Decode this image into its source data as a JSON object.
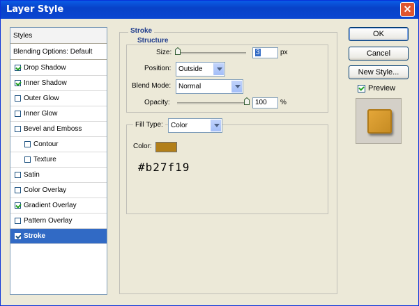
{
  "window": {
    "title": "Layer Style"
  },
  "styles_panel": {
    "header": "Styles",
    "blending_options": "Blending Options: Default",
    "items": [
      {
        "label": "Drop Shadow",
        "checked": true,
        "selected": false
      },
      {
        "label": "Inner Shadow",
        "checked": true,
        "selected": false
      },
      {
        "label": "Outer Glow",
        "checked": false,
        "selected": false
      },
      {
        "label": "Inner Glow",
        "checked": false,
        "selected": false
      },
      {
        "label": "Bevel and Emboss",
        "checked": false,
        "selected": false
      },
      {
        "label": "Contour",
        "checked": false,
        "selected": false,
        "indent": true
      },
      {
        "label": "Texture",
        "checked": false,
        "selected": false,
        "indent": true
      },
      {
        "label": "Satin",
        "checked": false,
        "selected": false
      },
      {
        "label": "Color Overlay",
        "checked": false,
        "selected": false
      },
      {
        "label": "Gradient Overlay",
        "checked": true,
        "selected": false
      },
      {
        "label": "Pattern Overlay",
        "checked": false,
        "selected": false
      },
      {
        "label": "Stroke",
        "checked": true,
        "selected": true
      }
    ]
  },
  "stroke": {
    "group_label": "Stroke",
    "structure_label": "Structure",
    "size_label": "Size:",
    "size_value": "3",
    "size_unit": "px",
    "position_label": "Position:",
    "position_value": "Outside",
    "blend_mode_label": "Blend Mode:",
    "blend_mode_value": "Normal",
    "opacity_label": "Opacity:",
    "opacity_value": "100",
    "opacity_unit": "%",
    "fill_type_label": "Fill Type:",
    "fill_type_value": "Color",
    "color_label": "Color:",
    "color_hex": "#b27f19",
    "color_hex_label": "#b27f19"
  },
  "buttons": {
    "ok": "OK",
    "cancel": "Cancel",
    "new_style": "New Style...",
    "preview_label": "Preview",
    "preview_checked": true
  },
  "colors": {
    "titlebar": "#0842c8",
    "selection": "#316ac5",
    "group_label": "#1f3c8c",
    "stroke_color": "#b27f19"
  }
}
